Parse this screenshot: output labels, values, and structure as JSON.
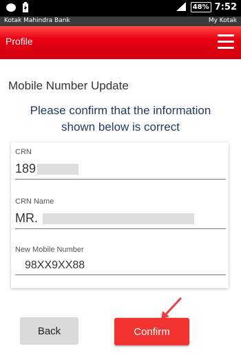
{
  "status": {
    "battery": "48%",
    "time": "7:52"
  },
  "appbar": {
    "left": "Kotak Mahindra Bank",
    "right": "My Kotak"
  },
  "header": {
    "title": "Profile"
  },
  "content": {
    "section_title": "Mobile Number Update",
    "subtitle": "Please confirm that the information shown below is correct"
  },
  "fields": [
    {
      "label": "CRN",
      "value": "189"
    },
    {
      "label": "CRN Name",
      "value": "MR. "
    },
    {
      "label": "New Mobile Number",
      "value": "98XX9XX88"
    }
  ],
  "buttons": {
    "back": "Back",
    "confirm": "Confirm"
  },
  "colors": {
    "accent": "#e80012",
    "confirm": "#f2332f"
  }
}
